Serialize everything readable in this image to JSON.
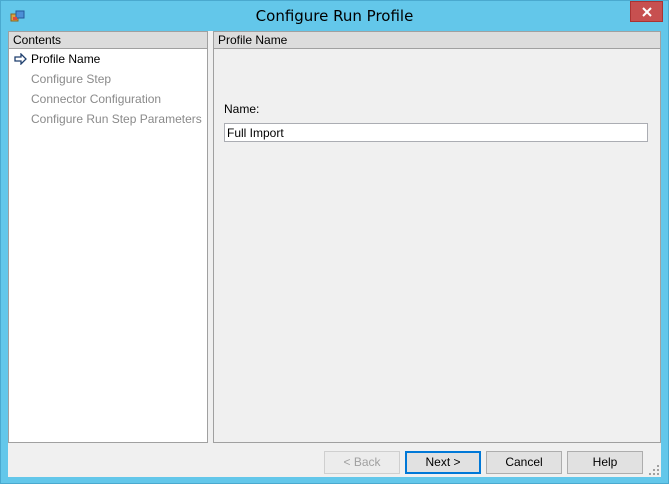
{
  "window": {
    "title": "Configure Run Profile",
    "close_glyph": "✕",
    "accent": "#63c7ea",
    "close_color": "#c75050"
  },
  "left_pane": {
    "header": "Contents",
    "items": [
      {
        "label": "Profile Name",
        "active": true
      },
      {
        "label": "Configure Step",
        "active": false
      },
      {
        "label": "Connector Configuration",
        "active": false
      },
      {
        "label": "Configure Run Step Parameters",
        "active": false
      }
    ]
  },
  "right_pane": {
    "header": "Profile Name",
    "name_label": "Name:",
    "name_value": "Full Import"
  },
  "buttons": {
    "back": "< Back",
    "next": "Next >",
    "cancel": "Cancel",
    "help": "Help"
  },
  "icons": {
    "app": "app-window-icon",
    "arrow": "right-arrow-icon",
    "grip": "resize-grip-icon"
  }
}
